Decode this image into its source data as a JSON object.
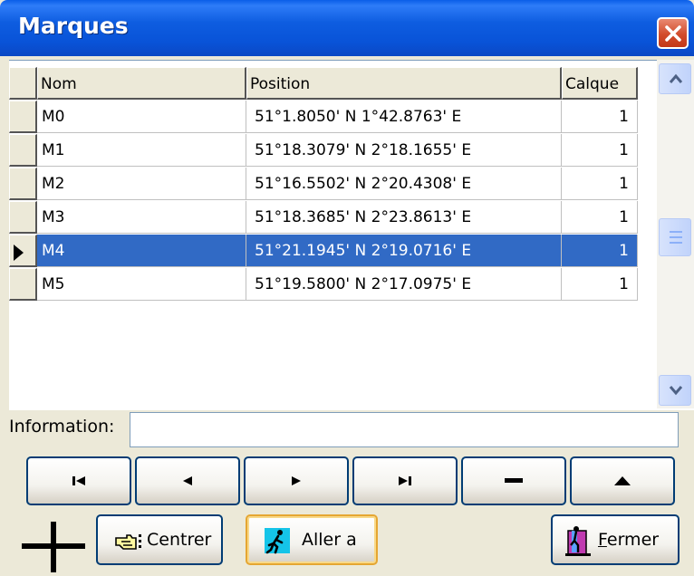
{
  "window": {
    "title": "Marques"
  },
  "grid": {
    "columns": [
      "Nom",
      "Position",
      "Calque"
    ],
    "rows": [
      {
        "nom": "M0",
        "position": "51°1.8050' N  1°42.8763' E",
        "calque": "1",
        "selected": false
      },
      {
        "nom": "M1",
        "position": "51°18.3079' N  2°18.1655' E",
        "calque": "1",
        "selected": false
      },
      {
        "nom": "M2",
        "position": "51°16.5502' N  2°20.4308' E",
        "calque": "1",
        "selected": false
      },
      {
        "nom": "M3",
        "position": "51°18.3685' N  2°23.8613' E",
        "calque": "1",
        "selected": false
      },
      {
        "nom": "M4",
        "position": "51°21.1945' N  2°19.0716' E",
        "calque": "1",
        "selected": true
      },
      {
        "nom": "M5",
        "position": "51°19.5800' N  2°17.0975' E",
        "calque": "1",
        "selected": false
      }
    ]
  },
  "info": {
    "label": "Information:",
    "value": ""
  },
  "nav_buttons": [
    "first-icon",
    "previous-icon",
    "next-icon",
    "last-icon",
    "minus-icon",
    "up-triangle-icon"
  ],
  "actions": {
    "centrer_label": "Centrer",
    "aller_label": "Aller a",
    "fermer_label": "Fermer",
    "fermer_mnemonic": "F",
    "fermer_rest": "ermer"
  },
  "colors": {
    "title_bar": "#0a5ee8",
    "selection": "#316ac5",
    "close_button": "#d24c2c",
    "default_button_border": "#e5a632"
  }
}
